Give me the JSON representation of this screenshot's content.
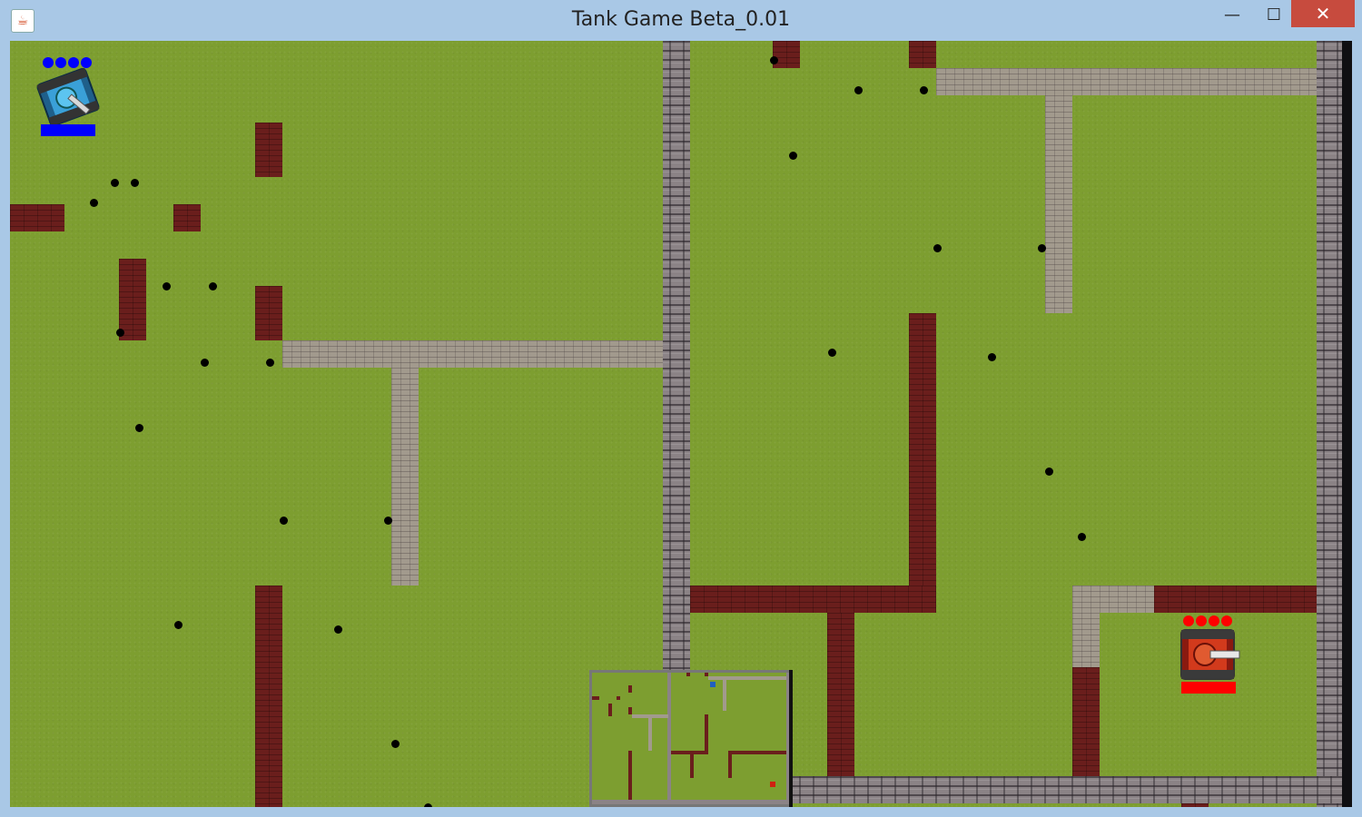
{
  "window": {
    "title": "Tank Game Beta_0.01",
    "app_icon": "java-coffee-icon",
    "controls": {
      "minimize": "—",
      "maximize": "☐",
      "close": "✕"
    }
  },
  "game": {
    "terrain_color": "#7d9e30",
    "brick_color": "#6a1e1c",
    "stone_color": "#a29a8d",
    "border_wall_color": "#8b8386",
    "player1": {
      "color": "#0000ff",
      "lives": 4,
      "health": 1.0,
      "tank_icon": "blue-tank-icon"
    },
    "player2": {
      "color": "#ff0000",
      "lives": 4,
      "health": 1.0,
      "tank_icon": "red-tank-icon"
    },
    "minimap": {
      "icon": "minimap-icon"
    }
  }
}
